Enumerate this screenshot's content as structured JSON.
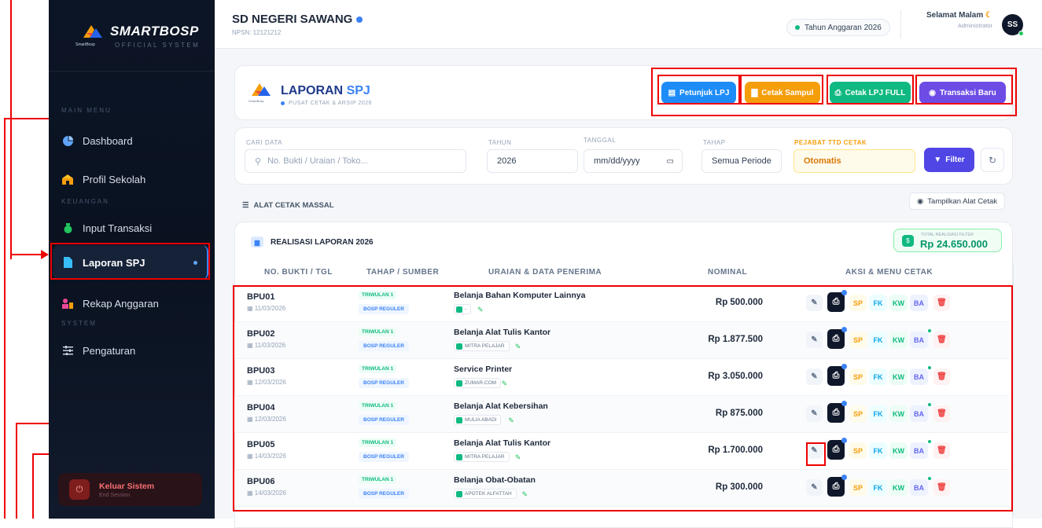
{
  "sidebar": {
    "brand": "SMARTBOSP",
    "brand_sub": "OFFICIAL SYSTEM",
    "logo_caption": "SmartBosp",
    "sections": {
      "main": "MAIN MENU",
      "keuangan": "KEUANGAN",
      "system": "SYSTEM"
    },
    "items": [
      {
        "label": "Dashboard",
        "icon": "pie-chart-icon"
      },
      {
        "label": "Profil Sekolah",
        "icon": "school-icon"
      },
      {
        "label": "Input Transaksi",
        "icon": "money-bag-icon"
      },
      {
        "label": "Laporan SPJ",
        "icon": "file-icon"
      },
      {
        "label": "Rekap Anggaran",
        "icon": "user-chart-icon"
      },
      {
        "label": "Pengaturan",
        "icon": "sliders-icon"
      }
    ],
    "logout": {
      "label": "Keluar Sistem",
      "sub": "End Session"
    }
  },
  "header": {
    "school": "SD NEGERI SAWANG",
    "npsn": "NPSN: 12121212",
    "tahun_badge": "Tahun Anggaran 2026",
    "greeting": "Selamat Malam",
    "role": "Administrator",
    "avatar": "SS"
  },
  "page": {
    "title_part1": "LAPORAN",
    "title_part2": "SPJ",
    "subtitle": "PUSAT CETAK & ARSIP 2026",
    "logo_caption": "SmartBosp",
    "buttons": {
      "petunjuk": "Petunjuk LPJ",
      "sampul": "Cetak Sampul",
      "full": "Cetak LPJ FULL",
      "baru": "Transaksi Baru"
    }
  },
  "filters": {
    "cari_label": "CARI DATA",
    "cari_placeholder": "No. Bukti / Uraian / Toko...",
    "tahun_label": "TAHUN",
    "tahun_value": "2026",
    "tanggal_label": "TANGGAL",
    "tanggal_value": "mm/dd/yyyy",
    "tahap_label": "TAHAP",
    "tahap_value": "Semua Periode",
    "pejabat_label": "PEJABAT TTD CETAK",
    "pejabat_value": "Otomatis",
    "filter_button": "Filter"
  },
  "mass_print": {
    "label": "ALAT CETAK MASSAL",
    "toggle": "Tampilkan Alat Cetak"
  },
  "report": {
    "title": "REALISASI LAPORAN 2026",
    "total_label": "TOTAL REALISASI FILTER",
    "total_value": "Rp 24.650.000"
  },
  "table": {
    "headers": [
      "NO. BUKTI / TGL",
      "TAHAP / SUMBER",
      "URAIAN & DATA PENERIMA",
      "NOMINAL",
      "AKSI & MENU CETAK"
    ],
    "action_labels": [
      "SP",
      "FK",
      "KW",
      "BA"
    ],
    "rows": [
      {
        "bukti": "BPU01",
        "tgl": "11/03/2026",
        "tahap": "TRIWULAN 1",
        "sumber": "BOSP REGULER",
        "uraian": "Belanja Bahan Komputer Lainnya",
        "toko": "-",
        "nominal": "Rp 500.000"
      },
      {
        "bukti": "BPU02",
        "tgl": "11/03/2026",
        "tahap": "TRIWULAN 1",
        "sumber": "BOSP REGULER",
        "uraian": "Belanja Alat Tulis Kantor",
        "toko": "MITRA PELAJAR",
        "nominal": "Rp 1.877.500"
      },
      {
        "bukti": "BPU03",
        "tgl": "12/03/2026",
        "tahap": "TRIWULAN 1",
        "sumber": "BOSP REGULER",
        "uraian": "Service Printer",
        "toko": "ZUMAR.COM",
        "nominal": "Rp 3.050.000"
      },
      {
        "bukti": "BPU04",
        "tgl": "12/03/2026",
        "tahap": "TRIWULAN 1",
        "sumber": "BOSP REGULER",
        "uraian": "Belanja Alat Kebersihan",
        "toko": "MULIA ABADI",
        "nominal": "Rp 875.000"
      },
      {
        "bukti": "BPU05",
        "tgl": "14/03/2026",
        "tahap": "TRIWULAN 1",
        "sumber": "BOSP REGULER",
        "uraian": "Belanja Alat Tulis Kantor",
        "toko": "MITRA PELAJAR",
        "nominal": "Rp 1.700.000"
      },
      {
        "bukti": "BPU06",
        "tgl": "14/03/2026",
        "tahap": "TRIWULAN 1",
        "sumber": "BOSP REGULER",
        "uraian": "Belanja Obat-Obatan",
        "toko": "APOTEK ALFATTAH",
        "nominal": "Rp 300.000"
      }
    ]
  },
  "colors": {
    "petunjuk": "#1d8cf8",
    "sampul": "#f59e0b",
    "full": "#10b981",
    "baru": "#6d4ce6",
    "filter": "#4f46e5",
    "annotation": "#e00000"
  }
}
